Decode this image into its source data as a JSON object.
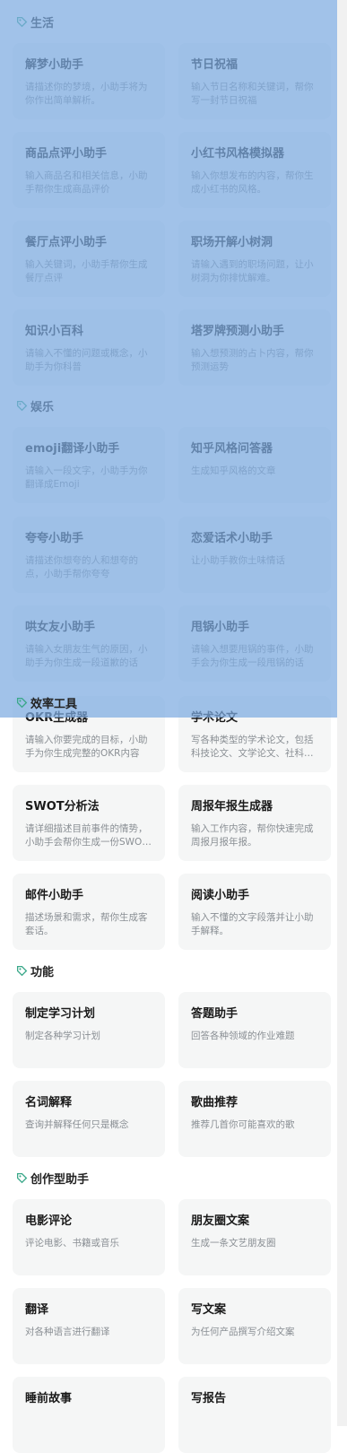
{
  "sections": {
    "life": {
      "title": "生活",
      "items": [
        {
          "title": "解梦小助手",
          "desc": "请描述你的梦境，小助手将为你作出简单解析。"
        },
        {
          "title": "节日祝福",
          "desc": "输入节日名称和关键词，帮你写一封节日祝福"
        },
        {
          "title": "商品点评小助手",
          "desc": "输入商品名和相关信息，小助手帮你生成商品评价"
        },
        {
          "title": "小红书风格模拟器",
          "desc": "输入你想发布的内容，帮你生成小红书的风格。"
        },
        {
          "title": "餐厅点评小助手",
          "desc": "输入关键词，小助手帮你生成餐厅点评"
        },
        {
          "title": "职场开解小树洞",
          "desc": "请输入遇到的职场问题，让小树洞为你排忧解难。"
        },
        {
          "title": "知识小百科",
          "desc": "请输入不懂的问题或概念，小助手为你科普"
        },
        {
          "title": "塔罗牌预测小助手",
          "desc": "输入想预测的占卜内容，帮你预测运势"
        }
      ]
    },
    "fun": {
      "title": "娱乐",
      "items": [
        {
          "title": "emoji翻译小助手",
          "desc": "请输入一段文字，小助手为你翻译成Emoji"
        },
        {
          "title": "知乎风格问答器",
          "desc": "生成知乎风格的文章"
        },
        {
          "title": "夸夸小助手",
          "desc": "请描述你想夸的人和想夸的点，小助手帮你夸夸"
        },
        {
          "title": "恋爱话术小助手",
          "desc": "让小助手教你土味情话"
        },
        {
          "title": "哄女友小助手",
          "desc": "请输入女朋友生气的原因，小助手为你生成一段道歉的话"
        },
        {
          "title": "甩锅小助手",
          "desc": "请输入想要甩锅的事件，小助手会为你生成一段甩锅的话"
        }
      ]
    },
    "efficiency": {
      "title": "效率工具",
      "items": [
        {
          "title": "OKR生成器",
          "desc": "请输入你要完成的目标，小助手为你生成完整的OKR内容"
        },
        {
          "title": "学术论文",
          "desc": "写各种类型的学术论文，包括科技论文、文学论文、社科论文"
        },
        {
          "title": "SWOT分析法",
          "desc": "请详细描述目前事件的情势，小助手会帮你生成一份SWOT分析"
        },
        {
          "title": "周报年报生成器",
          "desc": "输入工作内容，帮你快速完成周报月报年报。"
        },
        {
          "title": "邮件小助手",
          "desc": "描述场景和需求，帮你生成客套话。"
        },
        {
          "title": "阅读小助手",
          "desc": "输入不懂的文字段落并让小助手解释。"
        }
      ]
    },
    "function": {
      "title": "功能",
      "items": [
        {
          "title": "制定学习计划",
          "desc": "制定各种学习计划"
        },
        {
          "title": "答题助手",
          "desc": "回答各种领域的作业难题"
        },
        {
          "title": "名词解释",
          "desc": "查询并解释任何只是概念"
        },
        {
          "title": "歌曲推荐",
          "desc": "推荐几首你可能喜欢的歌"
        }
      ]
    },
    "creative": {
      "title": "创作型助手",
      "items": [
        {
          "title": "电影评论",
          "desc": "评论电影、书籍或音乐"
        },
        {
          "title": "朋友圈文案",
          "desc": "生成一条文艺朋友圈"
        },
        {
          "title": "翻译",
          "desc": "对各种语言进行翻译"
        },
        {
          "title": "写文案",
          "desc": "为任何产品撰写介绍文案"
        },
        {
          "title": "睡前故事",
          "desc": ""
        },
        {
          "title": "写报告",
          "desc": ""
        }
      ]
    }
  },
  "icons": {
    "section_tag": "tag-icon"
  },
  "colors": {
    "tag_icon": "#3aa889",
    "overlay": "#7daae1"
  }
}
